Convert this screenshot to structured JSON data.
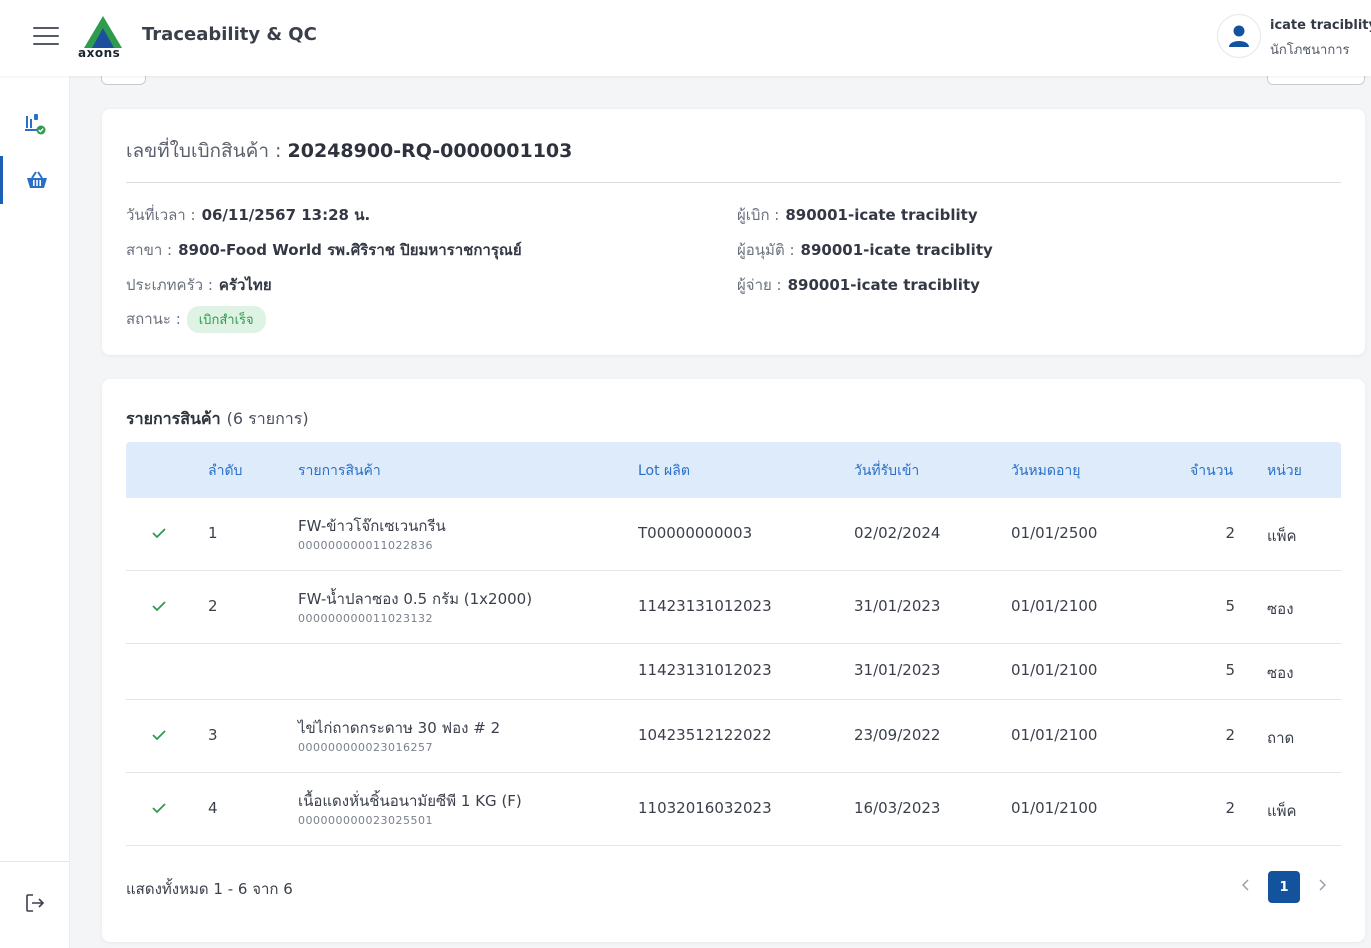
{
  "header": {
    "app_title": "Traceability & QC",
    "logo_text": "axons",
    "user_name": "icate traciblity",
    "user_role": "นักโภชนาการ"
  },
  "sidebar": {
    "items": [
      {
        "icon": "scale-check-icon",
        "active": false
      },
      {
        "icon": "basket-icon",
        "active": true
      }
    ],
    "logout_icon": "logout-icon"
  },
  "requisition": {
    "number_label": "เลขที่ใบเบิกสินค้า :",
    "number_value": "20248900-RQ-0000001103",
    "datetime_label": "วันที่เวลา :",
    "datetime_value": "06/11/2567 13:28 น.",
    "branch_label": "สาขา :",
    "branch_value": "8900-Food World รพ.ศิริราช ปิยมหาราชการุณย์",
    "kitchen_label": "ประเภทครัว :",
    "kitchen_value": "ครัวไทย",
    "status_label": "สถานะ :",
    "status_value": "เบิกสำเร็จ",
    "requester_label": "ผู้เบิก :",
    "requester_value": "890001-icate traciblity",
    "approver_label": "ผู้อนุมัติ :",
    "approver_value": "890001-icate traciblity",
    "dispenser_label": "ผู้จ่าย :",
    "dispenser_value": "890001-icate traciblity"
  },
  "items": {
    "title": "รายการสินค้า",
    "count_text": "(6 รายการ)",
    "columns": {
      "seq": "ลำดับ",
      "item": "รายการสินค้า",
      "lot": "Lot ผลิต",
      "received": "วันที่รับเข้า",
      "expiry": "วันหมดอายุ",
      "qty": "จำนวน",
      "unit": "หน่วย"
    },
    "rows": [
      {
        "checked": true,
        "seq": "1",
        "name": "FW-ข้าวโจ๊กเซเวนกรีน",
        "code": "000000000011022836",
        "lot": "T00000000003",
        "received": "02/02/2024",
        "expiry": "01/01/2500",
        "qty": "2",
        "unit": "แพ็ค"
      },
      {
        "checked": true,
        "seq": "2",
        "name": "FW-น้ำปลาซอง 0.5 กรัม (1x2000)",
        "code": "000000000011023132",
        "lot": "11423131012023",
        "received": "31/01/2023",
        "expiry": "01/01/2100",
        "qty": "5",
        "unit": "ซอง"
      },
      {
        "checked": false,
        "seq": "",
        "name": "",
        "code": "",
        "lot": "11423131012023",
        "received": "31/01/2023",
        "expiry": "01/01/2100",
        "qty": "5",
        "unit": "ซอง"
      },
      {
        "checked": true,
        "seq": "3",
        "name": "ไข่ไก่ถาดกระดาษ 30 ฟอง # 2",
        "code": "000000000023016257",
        "lot": "10423512122022",
        "received": "23/09/2022",
        "expiry": "01/01/2100",
        "qty": "2",
        "unit": "ถาด"
      },
      {
        "checked": true,
        "seq": "4",
        "name": "เนื้อแดงหั่นชิ้นอนามัยซีพี 1 KG (F)",
        "code": "000000000023025501",
        "lot": "11032016032023",
        "received": "16/03/2023",
        "expiry": "01/01/2100",
        "qty": "2",
        "unit": "แพ็ค"
      }
    ],
    "footer_text": "แสดงทั้งหมด 1 - 6 จาก 6",
    "current_page": "1"
  },
  "colors": {
    "primary": "#13539e",
    "header_bg": "#deebfa",
    "check": "#2e9b4e",
    "status_bg": "#dff3e4"
  }
}
